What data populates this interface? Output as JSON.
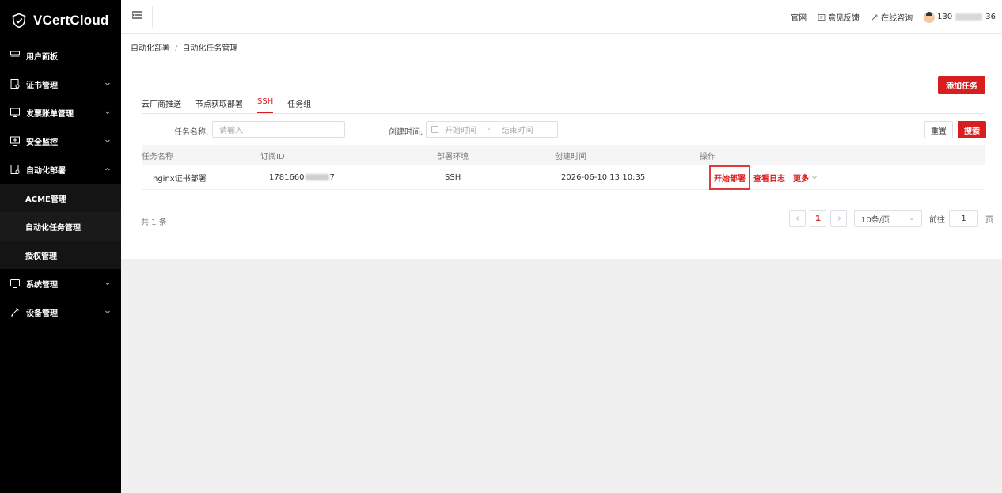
{
  "brand": {
    "name": "VCertCloud"
  },
  "sidebar": {
    "items": [
      {
        "label": "用户面板",
        "icon": "dashboard-icon",
        "expandable": false
      },
      {
        "label": "证书管理",
        "icon": "certificate-icon",
        "expandable": true
      },
      {
        "label": "发票账单管理",
        "icon": "invoice-icon",
        "expandable": true
      },
      {
        "label": "安全监控",
        "icon": "monitor-icon",
        "expandable": true
      },
      {
        "label": "自动化部署",
        "icon": "deploy-icon",
        "expandable": true,
        "expanded": true
      },
      {
        "label": "系统管理",
        "icon": "system-icon",
        "expandable": true
      },
      {
        "label": "设备管理",
        "icon": "device-icon",
        "expandable": true
      }
    ],
    "submenu": [
      {
        "label": "ACME管理"
      },
      {
        "label": "自动化任务管理",
        "active": true
      },
      {
        "label": "授权管理"
      }
    ]
  },
  "topbar": {
    "links": [
      {
        "label": "官网"
      },
      {
        "label": "意见反馈"
      },
      {
        "label": "在线咨询"
      }
    ],
    "user_prefix": "130",
    "user_suffix": "36"
  },
  "breadcrumb": {
    "parent": "自动化部署",
    "sep": "/",
    "current": "自动化任务管理"
  },
  "add_task_button": "添加任务",
  "tabs": [
    {
      "label": "云厂商推送"
    },
    {
      "label": "节点获取部署"
    },
    {
      "label": "SSH",
      "active": true
    },
    {
      "label": "任务组"
    }
  ],
  "filter": {
    "name_label": "任务名称:",
    "name_placeholder": "请输入",
    "time_label": "创建时间:",
    "start_placeholder": "开始时间",
    "range_sep": "-",
    "end_placeholder": "结束时间",
    "reset": "重置",
    "search": "搜索"
  },
  "table": {
    "headers": [
      "任务名称",
      "订阅ID",
      "部署环境",
      "创建时间",
      "操作"
    ],
    "rows": [
      {
        "name": "nginx证书部署",
        "id_prefix": "1781660",
        "id_suffix": "7",
        "env": "SSH",
        "created": "2026-06-10 13:10:35",
        "actions": {
          "start": "开始部署",
          "log": "查看日志",
          "more": "更多"
        }
      }
    ]
  },
  "pagination": {
    "total": "共 1 条",
    "current_page": "1",
    "page_size": "10条/页",
    "goto_label": "前往",
    "goto_value": "1",
    "page_unit": "页"
  },
  "colors": {
    "accent": "#d81e1e",
    "sidebar_bg": "#000000"
  }
}
